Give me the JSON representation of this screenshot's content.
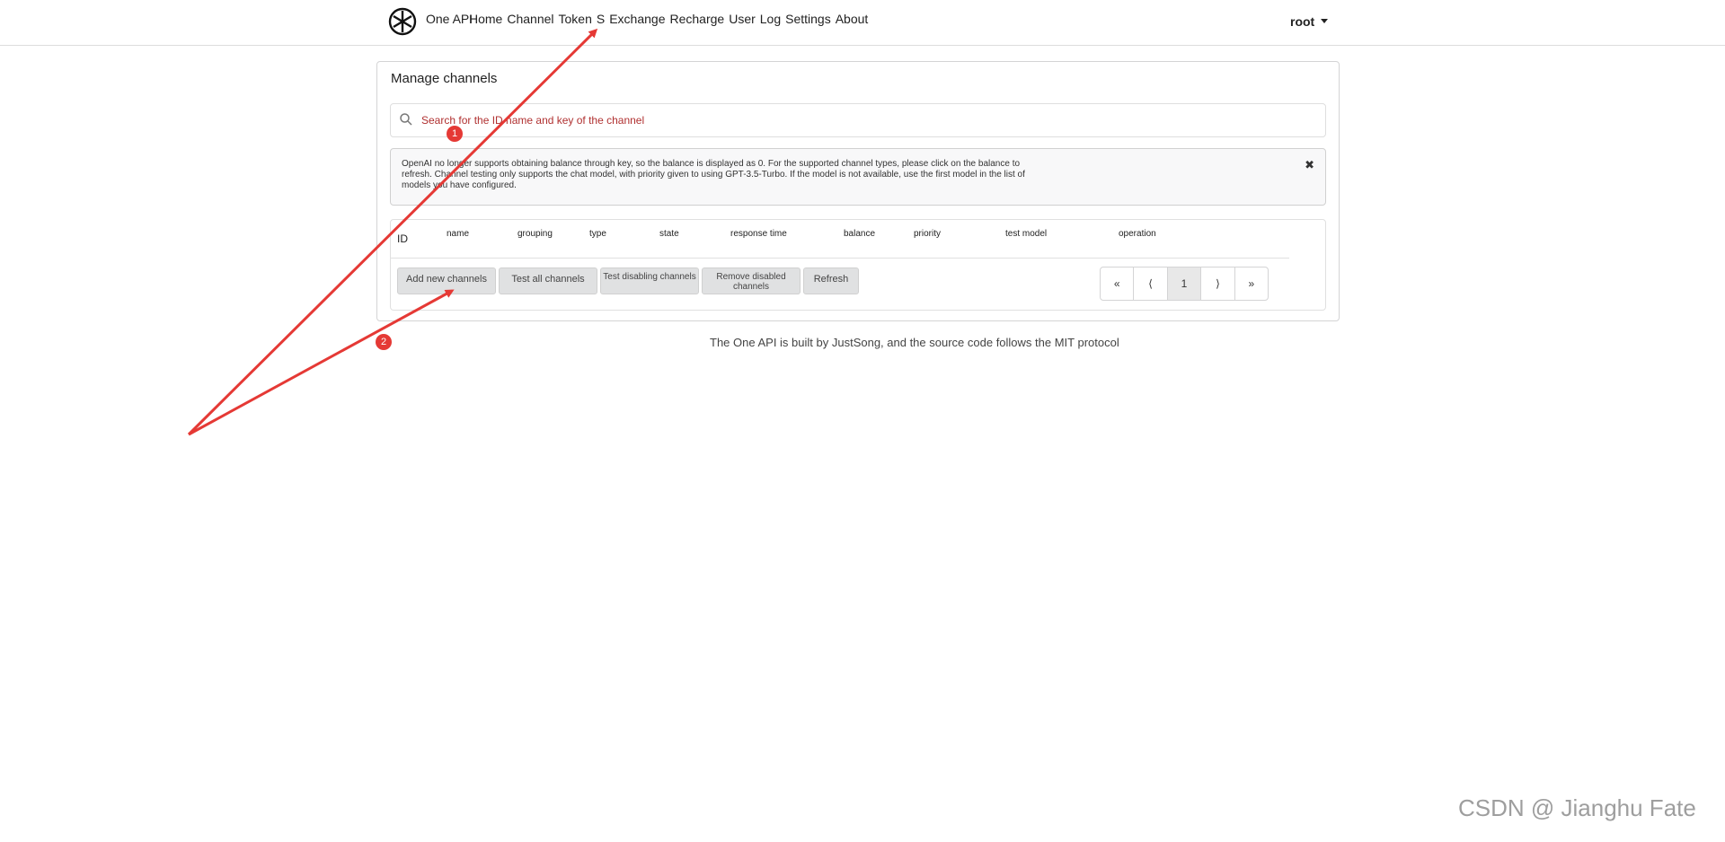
{
  "header": {
    "brand": "One API",
    "nav": [
      "Home",
      "Channel",
      "Token",
      "S",
      "Exchange",
      "Recharge",
      "User",
      "Log",
      "Settings",
      "About"
    ],
    "user": "root"
  },
  "card": {
    "title": "Manage channels",
    "search_placeholder": "Search for the ID name and key of the channel",
    "message": "OpenAI no longer supports obtaining balance through key, so the balance is displayed as 0. For the supported channel types, please click on the balance to refresh. Channel testing only supports the chat model, with priority given to using GPT-3.5-Turbo. If the model is not available, use the first model in the list of models you have configured.",
    "columns": [
      "ID",
      "name",
      "grouping",
      "type",
      "state",
      "response time",
      "balance",
      "priority",
      "test model",
      "operation"
    ],
    "buttons": {
      "add": "Add new channels",
      "test_all": "Test all channels",
      "test_disabled": "Test disabling channels",
      "remove_disabled": "Remove disabled channels",
      "refresh": "Refresh"
    },
    "pagination": [
      "«",
      "⟨",
      "1",
      "⟩",
      "»"
    ]
  },
  "footer": "The One API is built by JustSong, and the source code follows the MIT protocol",
  "annotations": {
    "badge_1": "1",
    "badge_2": "2",
    "arrow_color": "#e53935"
  },
  "watermark": "CSDN @ Jianghu Fate"
}
